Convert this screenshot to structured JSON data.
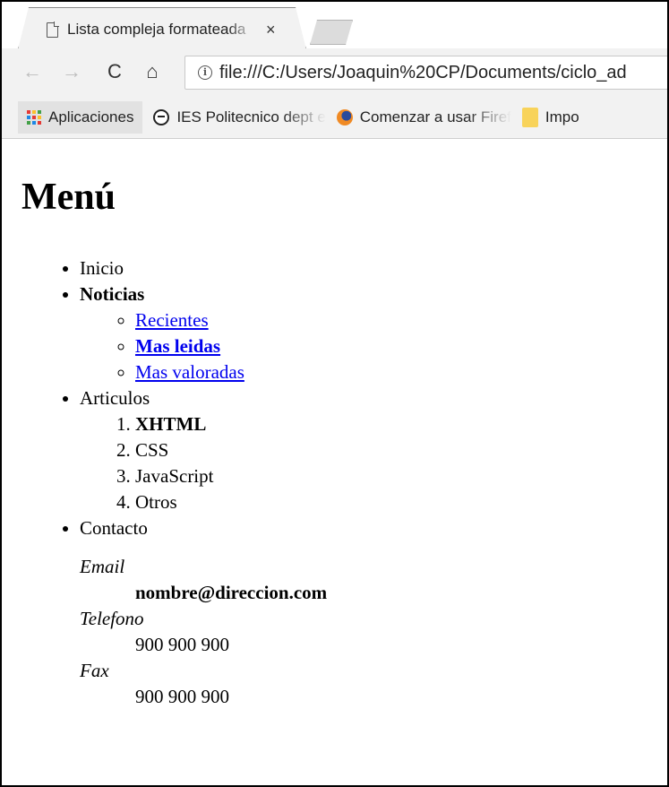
{
  "browser": {
    "tab_title": "Lista compleja formateada",
    "tab_close": "×",
    "url": "file:///C:/Users/Joaquin%20CP/Documents/ciclo_ad",
    "bookmarks": [
      {
        "label": "Aplicaciones",
        "icon": "apps-icon"
      },
      {
        "label": "IES Politecnico dept e",
        "icon": "face-icon"
      },
      {
        "label": "Comenzar a usar Firef",
        "icon": "firefox-icon"
      },
      {
        "label": "Impo",
        "icon": "folder-icon"
      }
    ],
    "icons": {
      "back": "←",
      "forward": "→",
      "reload": "C",
      "home": "⌂",
      "info": "i"
    }
  },
  "page": {
    "heading": "Menú",
    "menu": {
      "inicio": "Inicio",
      "noticias": "Noticias",
      "noticias_sub": [
        "Recientes",
        "Mas leidas",
        "Mas valoradas"
      ],
      "articulos": "Articulos",
      "articulos_sub": [
        "XHTML",
        "CSS",
        "JavaScript",
        "Otros"
      ],
      "contacto": "Contacto",
      "contact_details": [
        {
          "term": "Email",
          "value": "nombre@direccion.com"
        },
        {
          "term": "Telefono",
          "value": "900 900 900"
        },
        {
          "term": "Fax",
          "value": "900 900 900"
        }
      ]
    }
  },
  "colors": {
    "link": "#0000ee",
    "chrome_bg": "#f2f2f2",
    "apps_grid": [
      "#e53935",
      "#fbc02d",
      "#43a047",
      "#1e88e5",
      "#e53935",
      "#fbc02d",
      "#43a047",
      "#1e88e5",
      "#e53935"
    ]
  }
}
